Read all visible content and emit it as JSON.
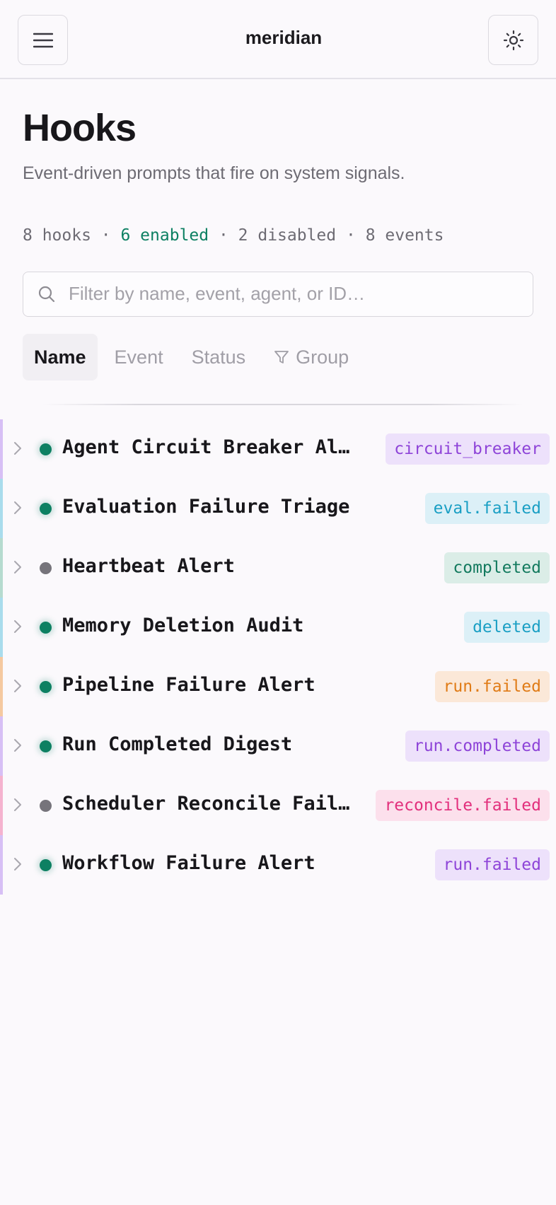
{
  "header": {
    "app_title": "meridian",
    "menu_icon": "hamburger-menu-icon",
    "theme_icon": "sun-icon"
  },
  "page": {
    "title": "Hooks",
    "subtitle": "Event-driven prompts that fire on system signals."
  },
  "stats": {
    "hooks": "8 hooks",
    "separator": " · ",
    "enabled": "6 enabled",
    "disabled": "2 disabled",
    "events": "8 events"
  },
  "search": {
    "placeholder": "Filter by name, event, agent, or ID…",
    "value": ""
  },
  "sort_tabs": [
    {
      "label": "Name",
      "active": true
    },
    {
      "label": "Event",
      "active": false
    },
    {
      "label": "Status",
      "active": false
    },
    {
      "label": "Group",
      "active": false,
      "icon": "filter-icon"
    }
  ],
  "hooks": [
    {
      "name": "Agent Circuit Breaker Alert",
      "enabled": true,
      "event": "circuit_breaker",
      "color": "#8e44d8",
      "bg": "#ede1fb",
      "stripe": "#d7bff5"
    },
    {
      "name": "Evaluation Failure Triage",
      "enabled": true,
      "event": "eval.failed",
      "color": "#1a9fc4",
      "bg": "#dcf0f7",
      "stripe": "#a9dcec"
    },
    {
      "name": "Heartbeat Alert",
      "enabled": false,
      "event": "completed",
      "color": "#137a5e",
      "bg": "#dbede7",
      "stripe": "#b6dbcf"
    },
    {
      "name": "Memory Deletion Audit",
      "enabled": true,
      "event": "deleted",
      "color": "#1a9fc4",
      "bg": "#dcf0f7",
      "stripe": "#a9dcec"
    },
    {
      "name": "Pipeline Failure Alert",
      "enabled": true,
      "event": "run.failed",
      "color": "#e07b16",
      "bg": "#fbe8d8",
      "stripe": "#f5c9a0"
    },
    {
      "name": "Run Completed Digest",
      "enabled": true,
      "event": "run.completed",
      "color": "#8e44d8",
      "bg": "#ede1fb",
      "stripe": "#d7bff5"
    },
    {
      "name": "Scheduler Reconcile Failure",
      "enabled": false,
      "event": "reconcile.failed",
      "color": "#e22f7c",
      "bg": "#fce0ec",
      "stripe": "#f5b3cf"
    },
    {
      "name": "Workflow Failure Alert",
      "enabled": true,
      "event": "run.failed",
      "color": "#8e44d8",
      "bg": "#ede1fb",
      "stripe": "#d7bff5"
    }
  ]
}
